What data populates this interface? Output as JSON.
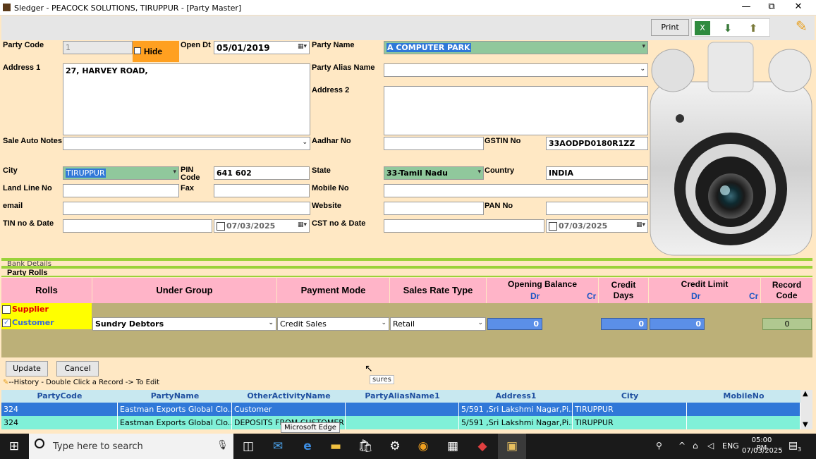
{
  "window": {
    "title": "Sledger - PEACOCK SOLUTIONS, TIRUPPUR - [Party Master]",
    "minimize": "—",
    "restore": "⧉",
    "close": "✕"
  },
  "toolbar": {
    "print": "Print"
  },
  "form": {
    "party_code_label": "Party Code",
    "party_code": "1",
    "hide_label": "Hide",
    "open_dt_label": "Open Dt",
    "open_dt": "05/01/2019",
    "party_name_label": "Party Name",
    "party_name": "A COMPUTER PARK",
    "address1_label": "Address 1",
    "address1": "27, HARVEY ROAD,",
    "alias_label": "Party Alias Name",
    "alias": "",
    "address2_label": "Address 2",
    "address2": "",
    "sale_auto_notes_label": "Sale Auto Notes",
    "sale_auto_notes": "",
    "aadhar_label": "Aadhar No",
    "aadhar": "",
    "gstin_label": "GSTIN No",
    "gstin": "33AODPD0180R1ZZ",
    "city_label": "City",
    "city": "TIRUPPUR",
    "pin_label": "PIN Code",
    "pin": "641 602",
    "state_label": "State",
    "state": "33-Tamil Nadu",
    "country_label": "Country",
    "country": "INDIA",
    "landline_label": "Land Line No",
    "landline": "",
    "fax_label": "Fax",
    "fax": "",
    "mobile_label": "Mobile No",
    "mobile": "",
    "email_label": "email",
    "email": "",
    "website_label": "Website",
    "website": "",
    "pan_label": "PAN No",
    "pan": "",
    "tin_label": "TIN no & Date",
    "tin_date": "07/03/2025",
    "cst_label": "CST no & Date",
    "cst_date": "07/03/2025"
  },
  "sections": {
    "bank": "Bank Details",
    "rolls": "Party Rolls"
  },
  "rolls": {
    "headers": {
      "rolls": "Rolls",
      "under_group": "Under Group",
      "payment_mode": "Payment Mode",
      "sales_rate_type": "Sales Rate Type",
      "opening_balance": "Opening Balance",
      "dr": "Dr",
      "cr": "Cr",
      "credit_days": "Credit Days",
      "credit": "Credit",
      "days": "Days",
      "credit_limit": "Credit Limit",
      "record": "Record",
      "code": "Code"
    },
    "supplier": "Supplier",
    "customer": "Customer",
    "under_group": "Sundry Debtors",
    "payment_mode": "Credit Sales",
    "sales_rate_type": "Retail",
    "opening_balance": "0",
    "credit_days": "0",
    "credit_limit": "0",
    "record_code": "0"
  },
  "actions": {
    "update": "Update",
    "cancel": "Cancel",
    "tooltip": "sures"
  },
  "history": {
    "label": "--History - Double Click a Record -> To Edit",
    "columns": [
      "PartyCode",
      "PartyName",
      "OtherActivityName",
      "PartyAliasName1",
      "Address1",
      "City",
      "MobileNo"
    ],
    "rows": [
      [
        "324",
        "Eastman Exports Global Clo...",
        "Customer",
        "",
        "5/591 ,Sri Lakshmi Nagar,Pi...",
        "TIRUPPUR",
        ""
      ],
      [
        "324",
        "Eastman Exports Global Clo...",
        "DEPOSITS FROM CUSTOMER",
        "",
        "5/591 ,Sri Lakshmi Nagar,Pi...",
        "TIRUPPUR",
        ""
      ]
    ],
    "edge_tooltip": "Microsoft Edge"
  },
  "taskbar": {
    "search": "Type here to search",
    "lang": "ENG",
    "time": "05:00 PM",
    "date": "07/03/2025",
    "notif": "3"
  },
  "colors": {
    "accent": "#3078d8",
    "form_bg": "#ffe8c4",
    "header_pink": "#ffb4c8",
    "olive": "#bcb078",
    "green_bar": "#9ad23a"
  }
}
